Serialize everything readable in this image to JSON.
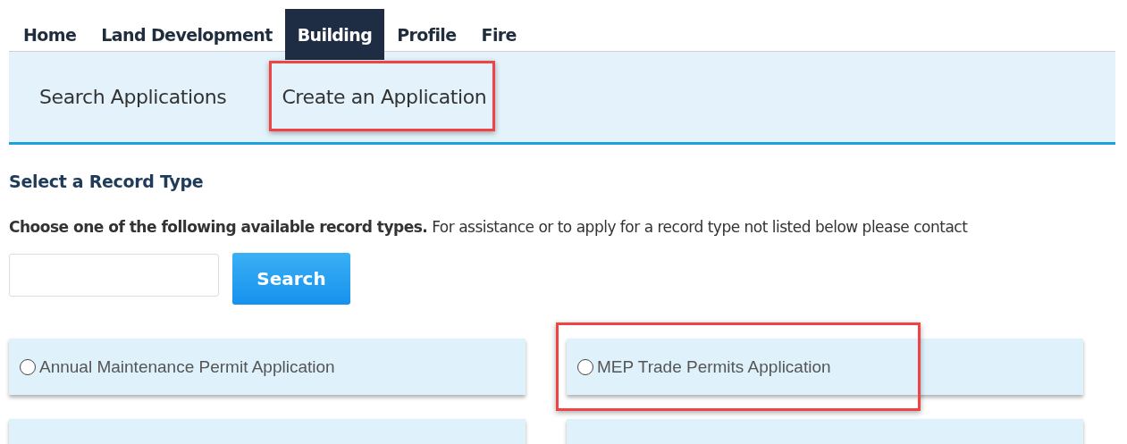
{
  "main_nav": {
    "tabs": [
      {
        "label": "Home",
        "selected": false
      },
      {
        "label": "Land Development",
        "selected": false
      },
      {
        "label": "Building",
        "selected": true
      },
      {
        "label": "Profile",
        "selected": false
      },
      {
        "label": "Fire",
        "selected": false
      }
    ]
  },
  "sub_nav": {
    "items": [
      {
        "label": "Search Applications",
        "highlighted": false
      },
      {
        "label": "Create an Application",
        "highlighted": true
      }
    ]
  },
  "section_title": "Select a Record Type",
  "instructions": "**Choose one of the following available record types.** For assistance or to apply for a record type not listed below please contact",
  "search": {
    "button": "Search"
  },
  "record_types": [
    {
      "label": "Annual Maintenance Permit Application",
      "selected": false,
      "highlighted": false
    },
    {
      "label": "MEP Trade Permits Application",
      "selected": false,
      "highlighted": true
    }
  ]
}
